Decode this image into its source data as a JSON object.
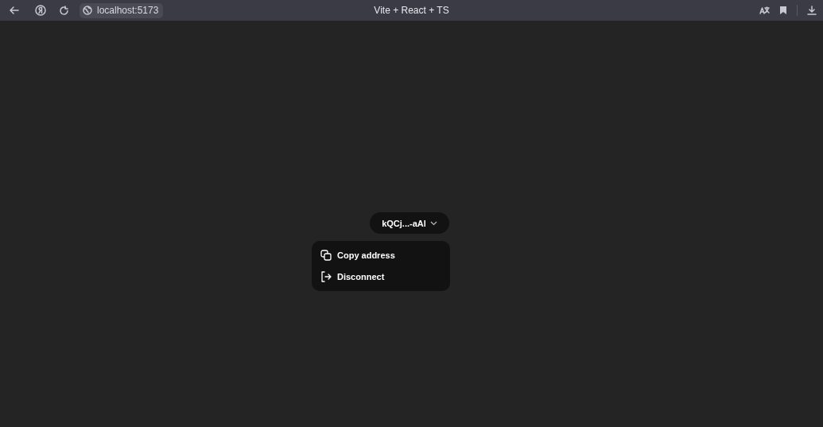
{
  "browser": {
    "url": "localhost:5173",
    "title": "Vite + React + TS"
  },
  "wallet_button": {
    "label": "kQCj...-aAl",
    "expanded": true
  },
  "menu": [
    {
      "kind": "copy",
      "label": "Copy address"
    },
    {
      "kind": "disconnect",
      "label": "Disconnect"
    }
  ]
}
